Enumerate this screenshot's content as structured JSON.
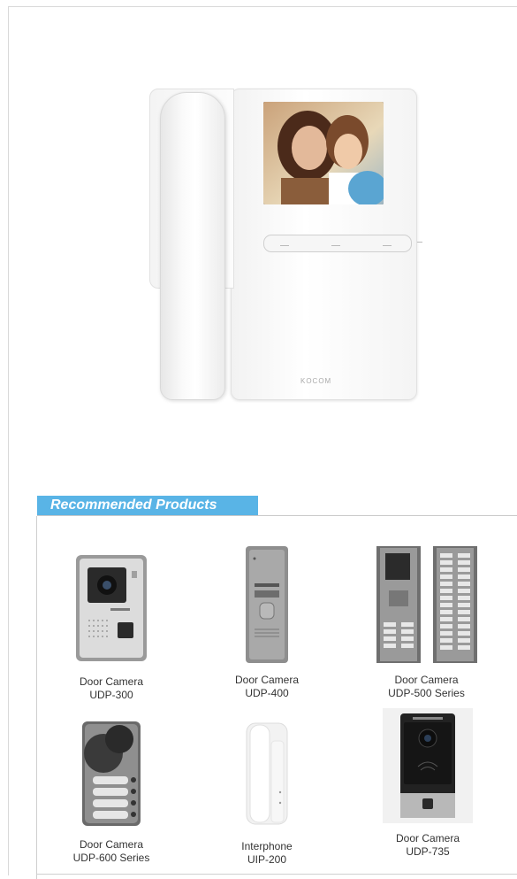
{
  "hero": {
    "brand_logo": "KOCOM",
    "colors": {
      "body": "#f7f7f7",
      "accent": "#59b4e6"
    }
  },
  "section": {
    "title": "Recommended Products"
  },
  "products": [
    {
      "line1": "Door Camera",
      "line2": "UDP-300",
      "icon": "door-camera-icon"
    },
    {
      "line1": "Door Camera",
      "line2": "UDP-400",
      "icon": "door-camera-icon"
    },
    {
      "line1": "Door Camera",
      "line2": "UDP-500 Series",
      "icon": "door-camera-icon"
    },
    {
      "line1": "Door Camera",
      "line2": "UDP-600 Series",
      "icon": "door-camera-icon"
    },
    {
      "line1": "Interphone",
      "line2": "UIP-200",
      "icon": "interphone-icon"
    },
    {
      "line1": "Door Camera",
      "line2": "UDP-735",
      "icon": "door-camera-icon"
    }
  ]
}
